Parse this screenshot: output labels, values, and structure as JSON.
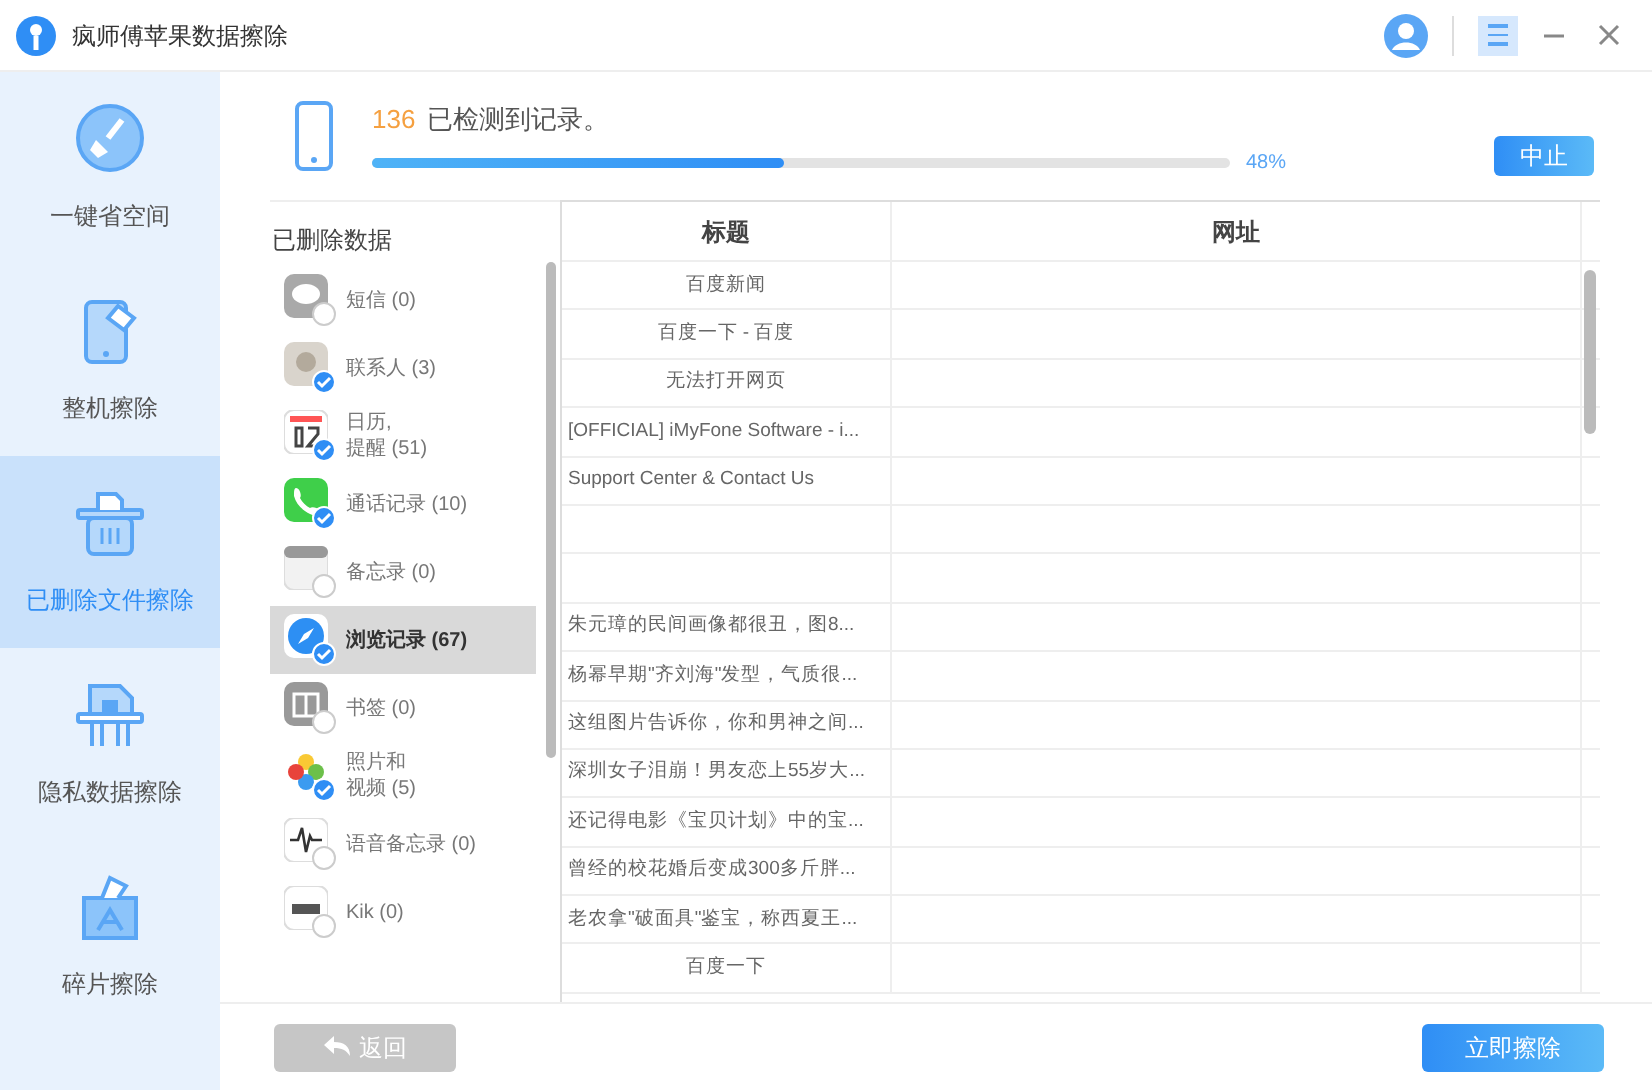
{
  "window": {
    "title": "疯师傅苹果数据擦除"
  },
  "sidebar": {
    "items": [
      {
        "kind": "broom",
        "label": "一键省空间",
        "selected": false
      },
      {
        "kind": "phone",
        "label": "整机擦除",
        "selected": false
      },
      {
        "kind": "trash",
        "label": "已删除文件擦除",
        "selected": true
      },
      {
        "kind": "lock",
        "label": "隐私数据擦除",
        "selected": false
      },
      {
        "kind": "folder",
        "label": "碎片擦除",
        "selected": false
      }
    ]
  },
  "scan": {
    "count": "136",
    "message": "已检测到记录。",
    "level": 0.48,
    "percent": "48%",
    "stop_button": "中止"
  },
  "deleted_data": {
    "heading": "已删除数据",
    "items": [
      {
        "kind": "message",
        "label": "短信 (0)",
        "checked": false,
        "selected": false
      },
      {
        "kind": "contacts",
        "label": "联系人 (3)",
        "checked": true,
        "selected": false
      },
      {
        "kind": "calendar",
        "label": [
          "日历,",
          "提醒 (51)"
        ],
        "checked": true,
        "selected": false
      },
      {
        "kind": "call",
        "label": "通话记录 (10)",
        "checked": true,
        "selected": false
      },
      {
        "kind": "notes",
        "label": "备忘录 (0)",
        "checked": false,
        "selected": false
      },
      {
        "kind": "browser",
        "label": "浏览记录 (67)",
        "checked": true,
        "selected": true
      },
      {
        "kind": "books",
        "label": "书签 (0)",
        "checked": false,
        "selected": false
      },
      {
        "kind": "photos",
        "label": [
          "照片和",
          "视频 (5)"
        ],
        "checked": true,
        "selected": false
      },
      {
        "kind": "voice",
        "label": "语音备忘录 (0)",
        "checked": false,
        "selected": false
      },
      {
        "kind": "kik",
        "label": "Kik (0)",
        "checked": false,
        "selected": false
      }
    ]
  },
  "table": {
    "columns": [
      "标题",
      "网址"
    ],
    "rows": [
      {
        "title": "百度新闻"
      },
      {
        "title": "百度一下 - 百度"
      },
      {
        "title": "无法打开网页"
      },
      {
        "title": "[OFFICIAL] iMyFone Software - i..."
      },
      {
        "title": "Support Center & Contact Us"
      },
      {},
      {},
      {
        "title": "朱元璋的民间画像都很丑，图8..."
      },
      {
        "title": "杨幂早期\"齐刘海\"发型，气质很..."
      },
      {
        "title": "这组图片告诉你，你和男神之间..."
      },
      {
        "title": "深圳女子泪崩！男友恋上55岁大..."
      },
      {
        "title": "还记得电影《宝贝计划》中的宝..."
      },
      {
        "title": "曾经的校花婚后变成300多斤胖..."
      },
      {
        "title": "老农拿\"破面具\"鉴宝，称西夏王..."
      },
      {
        "title": "百度一下"
      }
    ]
  },
  "footer": {
    "back_button": "返回",
    "erase_button": "立即擦除"
  }
}
